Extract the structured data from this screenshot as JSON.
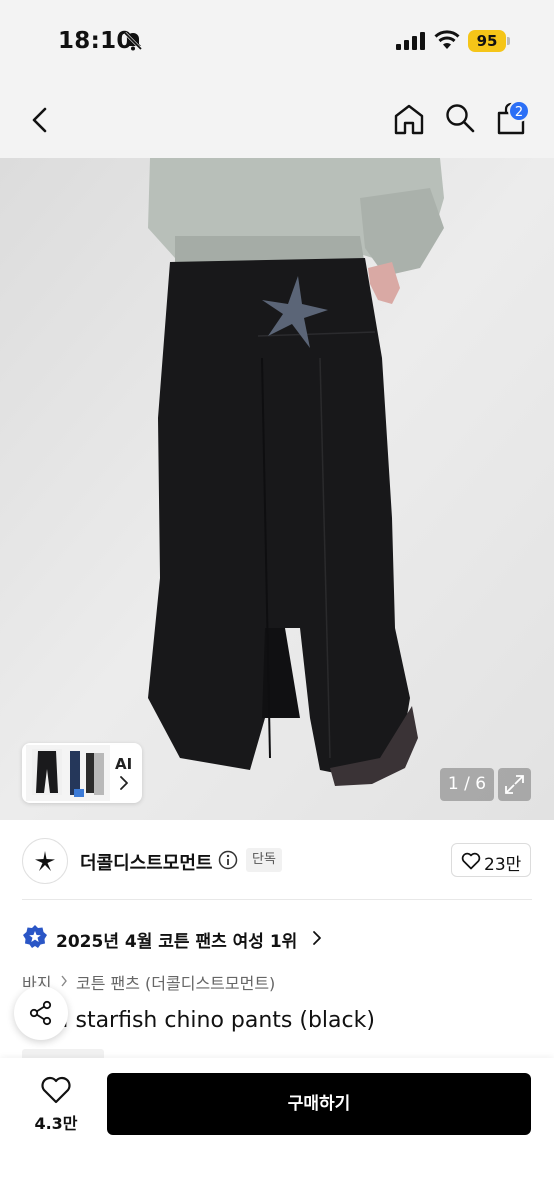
{
  "status_bar": {
    "time": "18:10",
    "battery": "95",
    "bell_icon": "bell-slash-icon",
    "signal_icon": "cellular-signal-icon",
    "wifi_icon": "wifi-icon",
    "battery_color": "#f5c518"
  },
  "nav": {
    "back_icon": "chevron-left-icon",
    "home_icon": "home-icon",
    "search_icon": "search-icon",
    "bag_icon": "shopping-bag-icon",
    "cart_count": "2",
    "badge_color": "#2b6ff6"
  },
  "gallery": {
    "ai_label": "AI",
    "counter": "1 / 6",
    "expand_icon": "expand-arrows-icon"
  },
  "brand": {
    "name": "더콜디스트모먼트",
    "exclusive_tag": "단독",
    "like_count": "23만",
    "logo_icon": "starfish-logo-icon"
  },
  "ranking": {
    "text": "2025년 4월 코튼 팬츠 여성 1위",
    "medal_icon": "ranking-medal-icon"
  },
  "breadcrumb": {
    "category": "바지",
    "subcategory": "코튼 팬츠 (더콜디스트모먼트)"
  },
  "product": {
    "title": "TCM starfish chino pants (black)"
  },
  "bottom": {
    "wish_count": "4.3만",
    "buy_label": "구매하기",
    "button_color": "#000000"
  }
}
